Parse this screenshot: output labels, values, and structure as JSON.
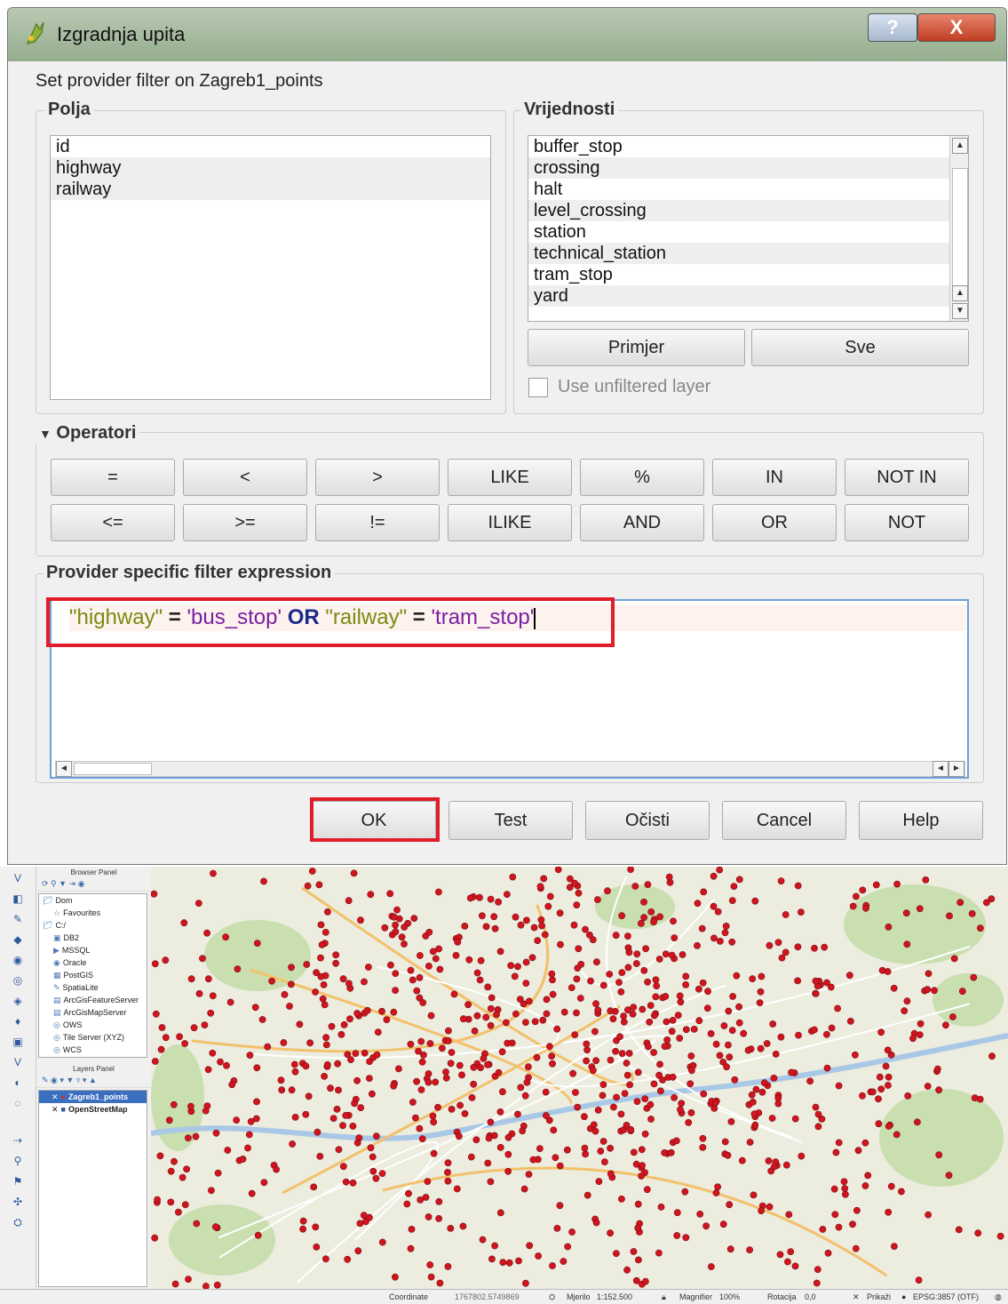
{
  "dialog": {
    "title": "Izgradnja upita",
    "help_label": "?",
    "close_label": "X",
    "subtitle": "Set provider filter on Zagreb1_points"
  },
  "fields": {
    "title": "Polja",
    "items": [
      "id",
      "highway",
      "railway"
    ]
  },
  "values": {
    "title": "Vrijednosti",
    "items": [
      "buffer_stop",
      "crossing",
      "halt",
      "level_crossing",
      "station",
      "technical_station",
      "tram_stop",
      "yard"
    ],
    "sample_label": "Primjer",
    "all_label": "Sve",
    "unfiltered_label": "Use unfiltered layer"
  },
  "operators": {
    "title": "Operatori",
    "row1": [
      "=",
      "<",
      ">",
      "LIKE",
      "%",
      "IN",
      "NOT IN"
    ],
    "row2": [
      "<=",
      ">=",
      "!=",
      "ILIKE",
      "AND",
      "OR",
      "NOT"
    ]
  },
  "expression": {
    "title": "Provider specific filter expression",
    "part1": "\"highway\"",
    "part2": " = ",
    "part3": "'bus_stop'",
    "part4": " OR ",
    "part5": "\"railway\"",
    "part6": " = ",
    "part7": "'tram_stop'"
  },
  "buttons": {
    "ok": "OK",
    "test": "Test",
    "clear": "Očisti",
    "cancel": "Cancel",
    "help": "Help"
  },
  "browser_panel": {
    "title": "Browser Panel",
    "items": [
      "Dom",
      "Favourites",
      "C:/",
      "DB2",
      "MSSQL",
      "Oracle",
      "PostGIS",
      "SpatiaLite",
      "ArcGisFeatureServer",
      "ArcGisMapServer",
      "OWS",
      "Tile Server (XYZ)",
      "WCS"
    ]
  },
  "layers_panel": {
    "title": "Layers Panel",
    "layers": [
      "Zagreb1_points",
      "OpenStreetMap"
    ]
  },
  "statusbar": {
    "coordinate_label": "Coordinate",
    "coordinate_value": "1767802.5749869",
    "scale_label": "Mjerilo",
    "scale_value": "1:152.500",
    "magnifier_label": "Magnifier",
    "magnifier_value": "100%",
    "rotation_label": "Rotacija",
    "rotation_value": "0,0",
    "render_label": "Prikaži",
    "crs": "EPSG:3857 (OTF)"
  },
  "colors": {
    "accent_red": "#e21d2a",
    "point_red": "#d0151f",
    "map_bg": "#ececdf"
  }
}
